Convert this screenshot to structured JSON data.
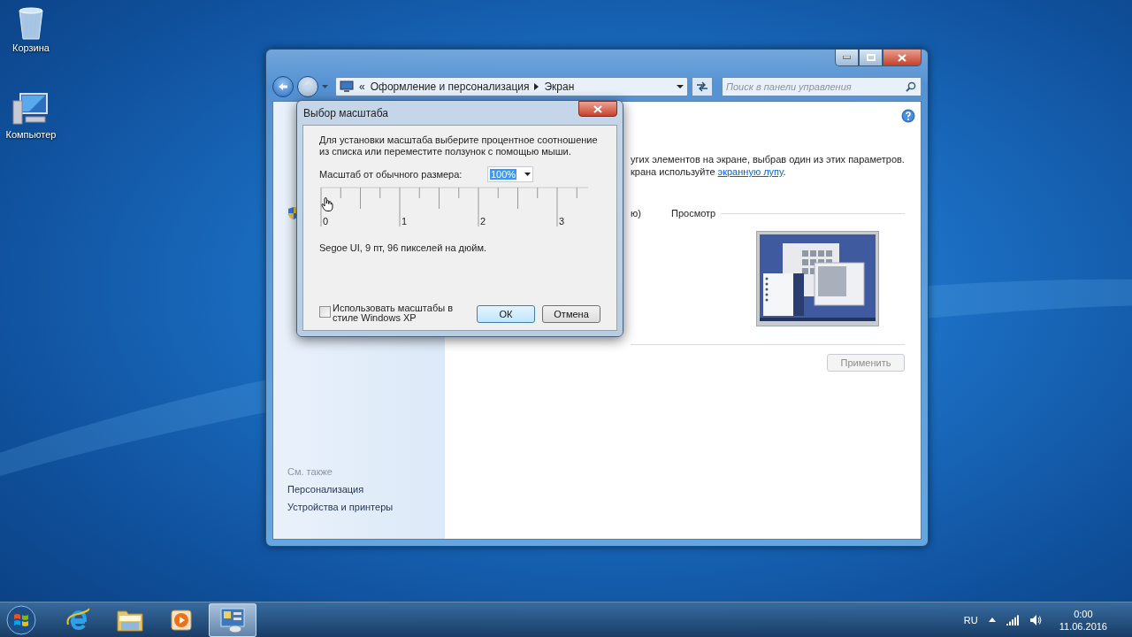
{
  "desktop_icons": [
    {
      "label": "Корзина",
      "kind": "recycle"
    },
    {
      "label": "Компьютер",
      "kind": "computer"
    }
  ],
  "window": {
    "address": {
      "overflow": "«",
      "path": [
        "Оформление и персонализация",
        "Экран"
      ]
    },
    "search": {
      "placeholder": "Поиск в панели управления"
    },
    "sidebar": {
      "see_also_title": "См. также",
      "links": [
        "Персонализация",
        "Устройства и принтеры"
      ]
    },
    "main": {
      "line_1": "угих элементов на экране, выбрав один из этих параметров.",
      "line_2": "крана используйте ",
      "link": "экранную лупу",
      "line_2_end": ".",
      "preview_fragment": "ю)",
      "preview_title": "Просмотр",
      "apply_button": {
        "label": "Применить",
        "disabled": true
      }
    }
  },
  "dialog": {
    "title": "Выбор масштаба",
    "description": [
      "Для установки масштаба выберите процентное соотношение",
      "из списка или переместите ползунок с помощью мыши."
    ],
    "scale_label": "Масштаб от обычного размера:",
    "scale_value": "100%",
    "ruler_labels": [
      "0",
      "1",
      "2",
      "3"
    ],
    "font_info": "Segoe UI, 9 пт, 96 пикселей на дюйм.",
    "xp_checkbox": {
      "label": "Использовать масштабы в стиле Windows XP",
      "checked": false
    },
    "buttons": [
      {
        "label": "ОК",
        "kind": "default"
      },
      {
        "label": "Отмена",
        "kind": "normal"
      }
    ]
  },
  "taskbar": {
    "items": [
      {
        "kind": "browser",
        "selected": false
      },
      {
        "kind": "folder",
        "selected": false
      },
      {
        "kind": "media",
        "selected": false
      },
      {
        "kind": "control-panel",
        "selected": true
      }
    ],
    "tray": {
      "language": "RU",
      "time": "0:00",
      "date": "11.06.2016"
    }
  }
}
